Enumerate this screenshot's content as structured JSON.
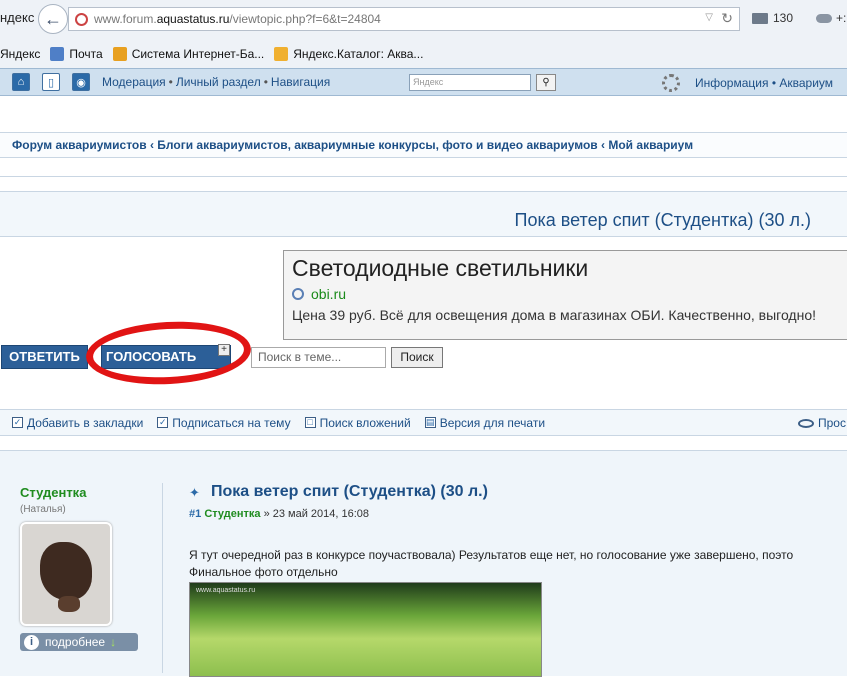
{
  "browser": {
    "yandex_label": "ндекс",
    "url_prefix": "www.forum.",
    "url_host": "aquastatus.ru",
    "url_path": "/viewtopic.php?f=6&t=24804",
    "mail_count": "130",
    "weather": "+:"
  },
  "bookmarks": [
    {
      "label": "Яндекс"
    },
    {
      "label": "Почта"
    },
    {
      "label": "Система Интернет-Ба..."
    },
    {
      "label": "Яндекс.Каталог: Аква..."
    }
  ],
  "forum_nav": {
    "links": [
      "Модерация",
      "Личный раздел",
      "Навигация"
    ],
    "search_placeholder": "Яндекс",
    "right_links": [
      "Информация",
      "Аквариум"
    ]
  },
  "breadcrumb": {
    "items": [
      "Форум аквариумистов",
      "Блоги аквариумистов, аквариумные конкурсы, фото и видео аквариумов",
      "Мой аквариум"
    ]
  },
  "topic": {
    "title": "Пока ветер спит (Студентка) (30 л.)"
  },
  "ad": {
    "title": "Светодиодные светильники",
    "domain": "obi.ru",
    "text": "Цена 39 руб. Всё для освещения дома в магазинах ОБИ. Качественно, выгодно!"
  },
  "actions": {
    "reply": "ОТВЕТИТЬ",
    "vote": "ГОЛОСОВАТЬ",
    "vote_plus": "+",
    "search_placeholder": "Поиск в теме...",
    "search_button": "Поиск"
  },
  "toolbar": {
    "items": [
      "Добавить в закладки",
      "Подписаться на тему",
      "Поиск вложений",
      "Версия для печати"
    ],
    "right": "Прос"
  },
  "post": {
    "author": "Студентка",
    "real_name": "(Наталья)",
    "more_label": "подробнее",
    "title": "Пока ветер спит (Студентка) (30 л.)",
    "number": "#1",
    "meta_author": "Студентка",
    "date": "» 23 май 2014, 16:08",
    "body_line1": "Я тут очередной раз в конкурсе поучаствовала) Результатов еще нет, но голосование уже завершено, поэто",
    "body_line2": "Финальное фото отдельно",
    "image_watermark": "www.aquastatus.ru"
  }
}
